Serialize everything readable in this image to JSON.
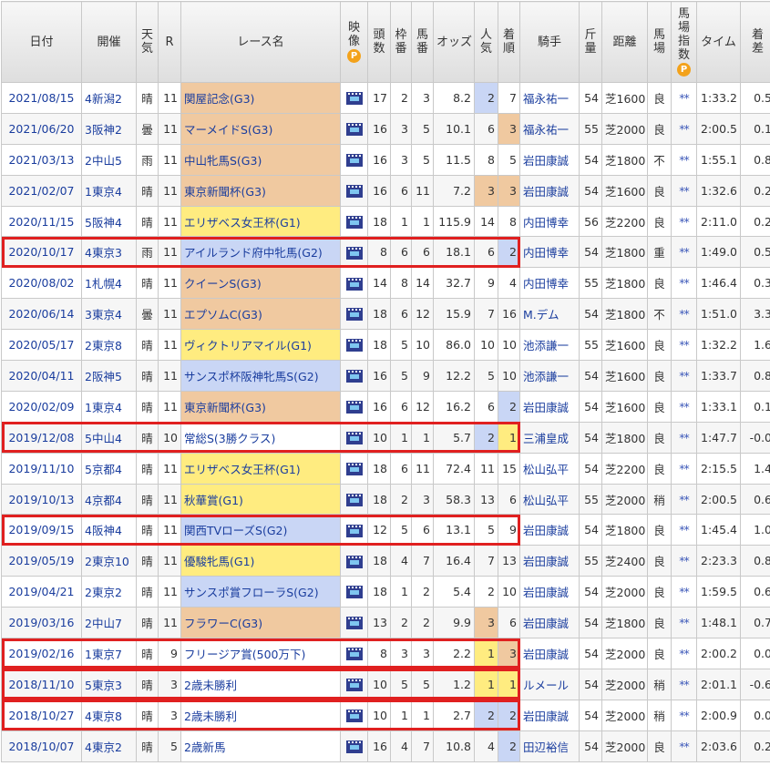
{
  "headers": {
    "date": "日付",
    "venue": "開催",
    "weather": "天気",
    "race_no": "R",
    "race_name": "レース名",
    "video": "映像",
    "heads": "頭数",
    "frame": "枠番",
    "horse_no": "馬番",
    "odds": "オッズ",
    "popularity": "人気",
    "finish": "着順",
    "jockey": "騎手",
    "weight": "斤量",
    "distance": "距離",
    "track": "馬場",
    "index": "馬場指数",
    "time": "タイム",
    "margin": "着差",
    "premium_badge": "P"
  },
  "rows": [
    {
      "date": "2021/08/15",
      "venue": "4新潟2",
      "weather": "晴",
      "r": "11",
      "race": "関屋記念(G3)",
      "grade": "g3",
      "heads": "17",
      "frame": "2",
      "horse": "3",
      "odds": "8.2",
      "pop": "2",
      "finish": "7",
      "jockey": "福永祐一",
      "kin": "54",
      "dist": "芝1600",
      "track": "良",
      "index": "**",
      "time": "1:33.2",
      "margin": "0.5",
      "pop_hl": "blue",
      "fin_hl": ""
    },
    {
      "date": "2021/06/20",
      "venue": "3阪神2",
      "weather": "曇",
      "r": "11",
      "race": "マーメイドS(G3)",
      "grade": "g3",
      "heads": "16",
      "frame": "3",
      "horse": "5",
      "odds": "10.1",
      "pop": "6",
      "finish": "3",
      "jockey": "福永祐一",
      "kin": "55",
      "dist": "芝2000",
      "track": "良",
      "index": "**",
      "time": "2:00.5",
      "margin": "0.1",
      "pop_hl": "",
      "fin_hl": "orange"
    },
    {
      "date": "2021/03/13",
      "venue": "2中山5",
      "weather": "雨",
      "r": "11",
      "race": "中山牝馬S(G3)",
      "grade": "g3",
      "heads": "16",
      "frame": "3",
      "horse": "5",
      "odds": "11.5",
      "pop": "8",
      "finish": "5",
      "jockey": "岩田康誠",
      "kin": "54",
      "dist": "芝1800",
      "track": "不",
      "index": "**",
      "time": "1:55.1",
      "margin": "0.8",
      "pop_hl": "",
      "fin_hl": ""
    },
    {
      "date": "2021/02/07",
      "venue": "1東京4",
      "weather": "晴",
      "r": "11",
      "race": "東京新聞杯(G3)",
      "grade": "g3",
      "heads": "16",
      "frame": "6",
      "horse": "11",
      "odds": "7.2",
      "pop": "3",
      "finish": "3",
      "jockey": "岩田康誠",
      "kin": "54",
      "dist": "芝1600",
      "track": "良",
      "index": "**",
      "time": "1:32.6",
      "margin": "0.2",
      "pop_hl": "orange",
      "fin_hl": "orange"
    },
    {
      "date": "2020/11/15",
      "venue": "5阪神4",
      "weather": "晴",
      "r": "11",
      "race": "エリザベス女王杯(G1)",
      "grade": "g1",
      "heads": "18",
      "frame": "1",
      "horse": "1",
      "odds": "115.9",
      "pop": "14",
      "finish": "8",
      "jockey": "内田博幸",
      "kin": "56",
      "dist": "芝2200",
      "track": "良",
      "index": "**",
      "time": "2:11.0",
      "margin": "0.2",
      "pop_hl": "",
      "fin_hl": ""
    },
    {
      "date": "2020/10/17",
      "venue": "4東京3",
      "weather": "雨",
      "r": "11",
      "race": "アイルランド府中牝馬(G2)",
      "grade": "g2",
      "heads": "8",
      "frame": "6",
      "horse": "6",
      "odds": "18.1",
      "pop": "6",
      "finish": "2",
      "jockey": "内田博幸",
      "kin": "54",
      "dist": "芝1800",
      "track": "重",
      "index": "**",
      "time": "1:49.0",
      "margin": "0.5",
      "pop_hl": "",
      "fin_hl": "blue"
    },
    {
      "date": "2020/08/02",
      "venue": "1札幌4",
      "weather": "晴",
      "r": "11",
      "race": "クイーンS(G3)",
      "grade": "g3",
      "heads": "14",
      "frame": "8",
      "horse": "14",
      "odds": "32.7",
      "pop": "9",
      "finish": "4",
      "jockey": "内田博幸",
      "kin": "55",
      "dist": "芝1800",
      "track": "良",
      "index": "**",
      "time": "1:46.4",
      "margin": "0.3",
      "pop_hl": "",
      "fin_hl": ""
    },
    {
      "date": "2020/06/14",
      "venue": "3東京4",
      "weather": "曇",
      "r": "11",
      "race": "エプソムC(G3)",
      "grade": "g3",
      "heads": "18",
      "frame": "6",
      "horse": "12",
      "odds": "15.9",
      "pop": "7",
      "finish": "16",
      "jockey": "M.デム",
      "kin": "54",
      "dist": "芝1800",
      "track": "不",
      "index": "**",
      "time": "1:51.0",
      "margin": "3.3",
      "pop_hl": "",
      "fin_hl": ""
    },
    {
      "date": "2020/05/17",
      "venue": "2東京8",
      "weather": "晴",
      "r": "11",
      "race": "ヴィクトリアマイル(G1)",
      "grade": "g1",
      "heads": "18",
      "frame": "5",
      "horse": "10",
      "odds": "86.0",
      "pop": "10",
      "finish": "10",
      "jockey": "池添謙一",
      "kin": "55",
      "dist": "芝1600",
      "track": "良",
      "index": "**",
      "time": "1:32.2",
      "margin": "1.6",
      "pop_hl": "",
      "fin_hl": ""
    },
    {
      "date": "2020/04/11",
      "venue": "2阪神5",
      "weather": "晴",
      "r": "11",
      "race": "サンスポ杯阪神牝馬S(G2)",
      "grade": "g2",
      "heads": "16",
      "frame": "5",
      "horse": "9",
      "odds": "12.2",
      "pop": "5",
      "finish": "10",
      "jockey": "池添謙一",
      "kin": "54",
      "dist": "芝1600",
      "track": "良",
      "index": "**",
      "time": "1:33.7",
      "margin": "0.8",
      "pop_hl": "",
      "fin_hl": ""
    },
    {
      "date": "2020/02/09",
      "venue": "1東京4",
      "weather": "晴",
      "r": "11",
      "race": "東京新聞杯(G3)",
      "grade": "g3",
      "heads": "16",
      "frame": "6",
      "horse": "12",
      "odds": "16.2",
      "pop": "6",
      "finish": "2",
      "jockey": "岩田康誠",
      "kin": "54",
      "dist": "芝1600",
      "track": "良",
      "index": "**",
      "time": "1:33.1",
      "margin": "0.1",
      "pop_hl": "",
      "fin_hl": "blue"
    },
    {
      "date": "2019/12/08",
      "venue": "5中山4",
      "weather": "晴",
      "r": "10",
      "race": "常総S(3勝クラス)",
      "grade": "op",
      "heads": "10",
      "frame": "1",
      "horse": "1",
      "odds": "5.7",
      "pop": "2",
      "finish": "1",
      "jockey": "三浦皇成",
      "kin": "54",
      "dist": "芝1800",
      "track": "良",
      "index": "**",
      "time": "1:47.7",
      "margin": "-0.0",
      "pop_hl": "blue",
      "fin_hl": "yellow"
    },
    {
      "date": "2019/11/10",
      "venue": "5京都4",
      "weather": "晴",
      "r": "11",
      "race": "エリザベス女王杯(G1)",
      "grade": "g1",
      "heads": "18",
      "frame": "6",
      "horse": "11",
      "odds": "72.4",
      "pop": "11",
      "finish": "15",
      "jockey": "松山弘平",
      "kin": "54",
      "dist": "芝2200",
      "track": "良",
      "index": "**",
      "time": "2:15.5",
      "margin": "1.4",
      "pop_hl": "",
      "fin_hl": ""
    },
    {
      "date": "2019/10/13",
      "venue": "4京都4",
      "weather": "晴",
      "r": "11",
      "race": "秋華賞(G1)",
      "grade": "g1",
      "heads": "18",
      "frame": "2",
      "horse": "3",
      "odds": "58.3",
      "pop": "13",
      "finish": "6",
      "jockey": "松山弘平",
      "kin": "55",
      "dist": "芝2000",
      "track": "稍",
      "index": "**",
      "time": "2:00.5",
      "margin": "0.6",
      "pop_hl": "",
      "fin_hl": ""
    },
    {
      "date": "2019/09/15",
      "venue": "4阪神4",
      "weather": "晴",
      "r": "11",
      "race": "関西TVローズS(G2)",
      "grade": "g2",
      "heads": "12",
      "frame": "5",
      "horse": "6",
      "odds": "13.1",
      "pop": "5",
      "finish": "9",
      "jockey": "岩田康誠",
      "kin": "54",
      "dist": "芝1800",
      "track": "良",
      "index": "**",
      "time": "1:45.4",
      "margin": "1.0",
      "pop_hl": "",
      "fin_hl": ""
    },
    {
      "date": "2019/05/19",
      "venue": "2東京10",
      "weather": "晴",
      "r": "11",
      "race": "優駿牝馬(G1)",
      "grade": "g1",
      "heads": "18",
      "frame": "4",
      "horse": "7",
      "odds": "16.4",
      "pop": "7",
      "finish": "13",
      "jockey": "岩田康誠",
      "kin": "55",
      "dist": "芝2400",
      "track": "良",
      "index": "**",
      "time": "2:23.3",
      "margin": "0.8",
      "pop_hl": "",
      "fin_hl": ""
    },
    {
      "date": "2019/04/21",
      "venue": "2東京2",
      "weather": "晴",
      "r": "11",
      "race": "サンスポ賞フローラS(G2)",
      "grade": "g2",
      "heads": "18",
      "frame": "1",
      "horse": "2",
      "odds": "5.4",
      "pop": "2",
      "finish": "10",
      "jockey": "岩田康誠",
      "kin": "54",
      "dist": "芝2000",
      "track": "良",
      "index": "**",
      "time": "1:59.5",
      "margin": "0.6",
      "pop_hl": "",
      "fin_hl": ""
    },
    {
      "date": "2019/03/16",
      "venue": "2中山7",
      "weather": "晴",
      "r": "11",
      "race": "フラワーC(G3)",
      "grade": "g3",
      "heads": "13",
      "frame": "2",
      "horse": "2",
      "odds": "9.9",
      "pop": "3",
      "finish": "6",
      "jockey": "岩田康誠",
      "kin": "54",
      "dist": "芝1800",
      "track": "良",
      "index": "**",
      "time": "1:48.1",
      "margin": "0.7",
      "pop_hl": "orange",
      "fin_hl": ""
    },
    {
      "date": "2019/02/16",
      "venue": "1東京7",
      "weather": "晴",
      "r": "9",
      "race": "フリージア賞(500万下)",
      "grade": "op",
      "heads": "8",
      "frame": "3",
      "horse": "3",
      "odds": "2.2",
      "pop": "1",
      "finish": "3",
      "jockey": "岩田康誠",
      "kin": "54",
      "dist": "芝2000",
      "track": "良",
      "index": "**",
      "time": "2:00.2",
      "margin": "0.0",
      "pop_hl": "yellow",
      "fin_hl": "orange"
    },
    {
      "date": "2018/11/10",
      "venue": "5東京3",
      "weather": "晴",
      "r": "3",
      "race": "2歳未勝利",
      "grade": "op",
      "heads": "10",
      "frame": "5",
      "horse": "5",
      "odds": "1.2",
      "pop": "1",
      "finish": "1",
      "jockey": "ルメール",
      "kin": "54",
      "dist": "芝2000",
      "track": "稍",
      "index": "**",
      "time": "2:01.1",
      "margin": "-0.6",
      "pop_hl": "yellow",
      "fin_hl": "yellow"
    },
    {
      "date": "2018/10/27",
      "venue": "4東京8",
      "weather": "晴",
      "r": "3",
      "race": "2歳未勝利",
      "grade": "op",
      "heads": "10",
      "frame": "1",
      "horse": "1",
      "odds": "2.7",
      "pop": "2",
      "finish": "2",
      "jockey": "岩田康誠",
      "kin": "54",
      "dist": "芝2000",
      "track": "稍",
      "index": "**",
      "time": "2:00.9",
      "margin": "0.0",
      "pop_hl": "blue",
      "fin_hl": "blue"
    },
    {
      "date": "2018/10/07",
      "venue": "4東京2",
      "weather": "晴",
      "r": "5",
      "race": "2歳新馬",
      "grade": "op",
      "heads": "16",
      "frame": "4",
      "horse": "7",
      "odds": "10.8",
      "pop": "4",
      "finish": "2",
      "jockey": "田辺裕信",
      "kin": "54",
      "dist": "芝2000",
      "track": "良",
      "index": "**",
      "time": "2:03.6",
      "margin": "0.2",
      "pop_hl": "",
      "fin_hl": "blue"
    }
  ],
  "highlighted_rows": [
    5,
    11,
    14,
    18,
    19,
    20
  ],
  "colors": {
    "link": "#1a3d9e",
    "g1": "#ffec80",
    "g2": "#c9d6f5",
    "g3": "#f0c9a0",
    "highlight_border": "#e02020",
    "premium_badge": "#f3a21b"
  }
}
